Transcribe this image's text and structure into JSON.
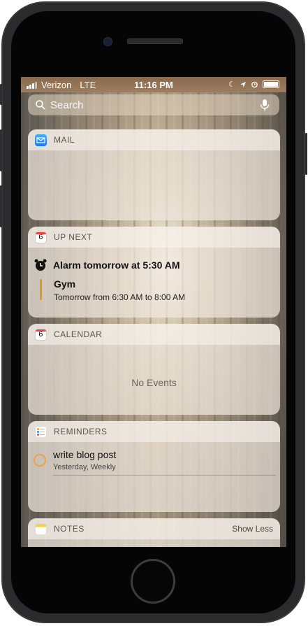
{
  "status_bar": {
    "carrier": "Verizon",
    "network": "LTE",
    "time": "11:16 PM"
  },
  "search": {
    "placeholder": "Search"
  },
  "widgets": {
    "mail": {
      "title": "MAIL"
    },
    "up_next": {
      "title": "UP NEXT",
      "icon_day": "6",
      "alarm": "Alarm tomorrow at 5:30 AM",
      "event_title": "Gym",
      "event_time": "Tomorrow from 6:30 AM to 8:00 AM",
      "event_color": "#d59d22"
    },
    "calendar": {
      "title": "CALENDAR",
      "icon_day": "6",
      "empty_text": "No Events"
    },
    "reminders": {
      "title": "REMINDERS",
      "item_title": "write blog post",
      "item_sub": "Yesterday, Weekly"
    },
    "notes": {
      "title": "NOTES",
      "action": "Show Less"
    }
  },
  "icons": [
    "signal-bars-icon",
    "moon-icon",
    "location-arrow-icon",
    "alarm-clock-icon",
    "battery-icon",
    "search-icon",
    "microphone-icon",
    "mail-app-icon",
    "calendar-app-icon",
    "reminders-app-icon",
    "notes-app-icon"
  ]
}
